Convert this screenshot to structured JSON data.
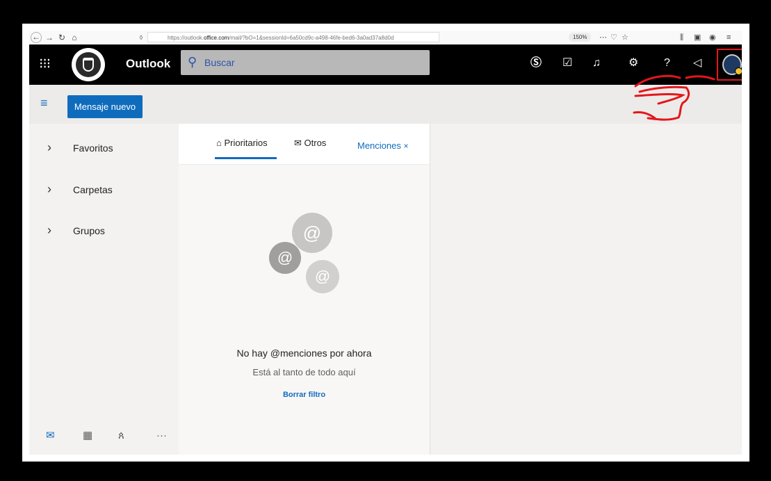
{
  "browser": {
    "url_prefix": "https://outlook.",
    "url_domain": "office.com",
    "url_suffix": "/mail/?bO=1&sessionId=6a50cd9c-a498-46fe-bed6-3a0ad37a8d0d",
    "zoom": "150%"
  },
  "app": {
    "name": "Outlook",
    "search_placeholder": "Buscar"
  },
  "command": {
    "new_message": "Mensaje nuevo"
  },
  "nav": {
    "items": [
      {
        "label": "Favoritos"
      },
      {
        "label": "Carpetas"
      },
      {
        "label": "Grupos"
      }
    ]
  },
  "tabs": {
    "focused": "Prioritarios",
    "other": "Otros",
    "mentions": "Menciones"
  },
  "empty": {
    "title": "No hay @menciones por ahora",
    "subtitle": "Está al tanto de todo aquí",
    "clear_filter": "Borrar filtro"
  },
  "colors": {
    "accent": "#0f6cbd",
    "topbar": "#000000",
    "annotation": "#e4161b"
  },
  "icons": [
    "app-launcher-icon",
    "skype-icon",
    "todo-icon",
    "bell-icon",
    "gear-icon",
    "help-icon",
    "feedback-icon",
    "mail-icon",
    "calendar-icon",
    "people-icon",
    "more-icon"
  ]
}
